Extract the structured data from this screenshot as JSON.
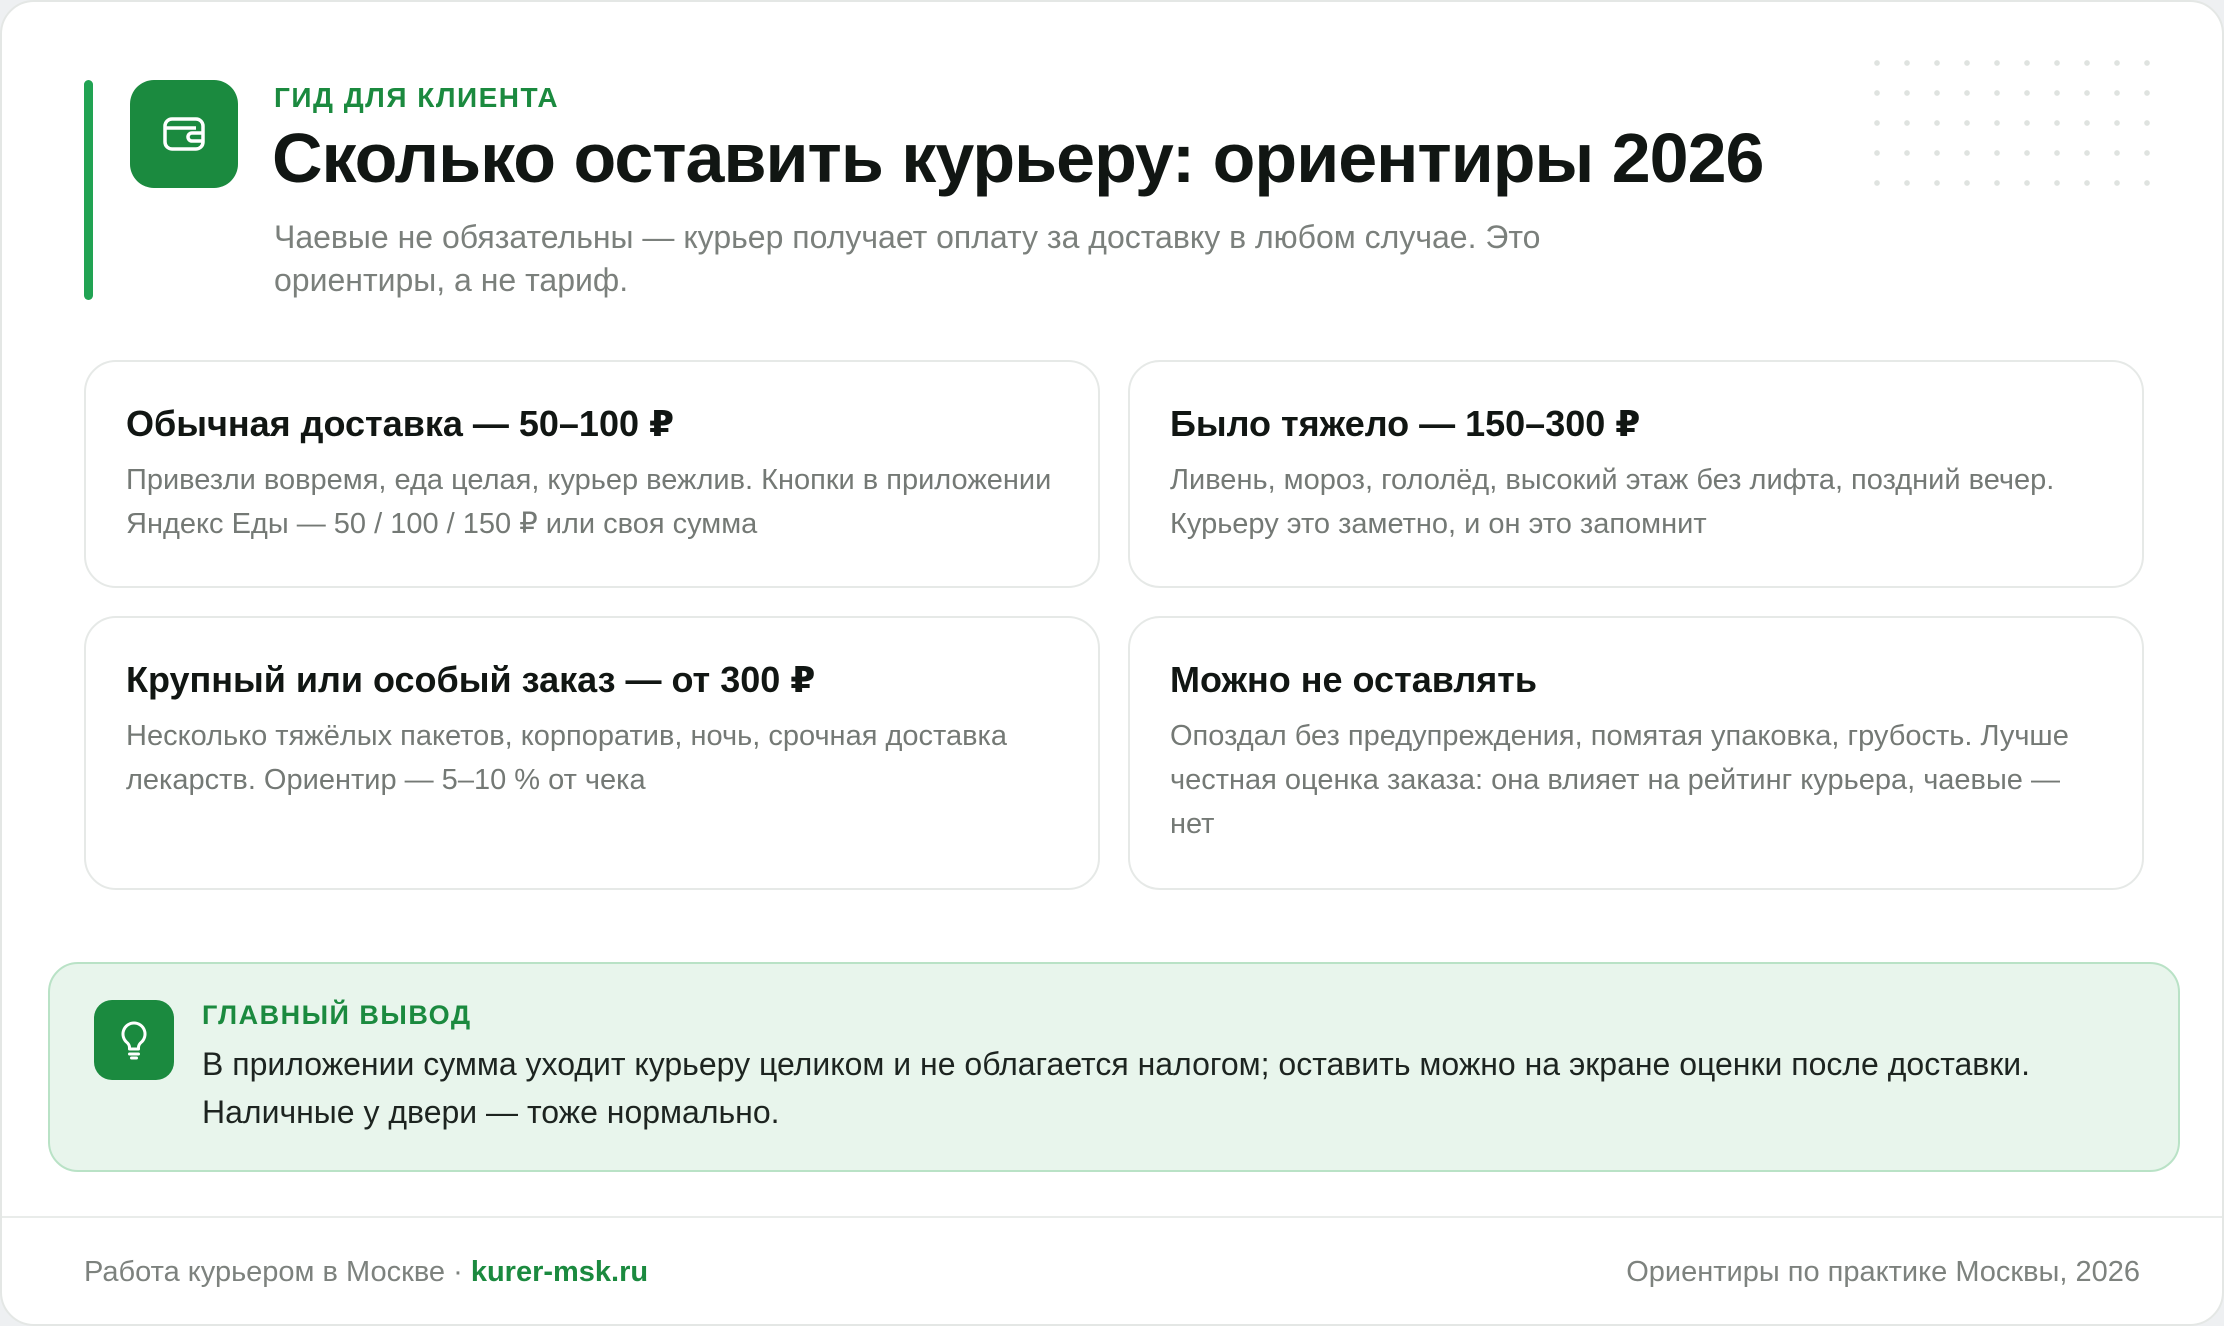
{
  "header": {
    "eyebrow": "ГИД ДЛЯ КЛИЕНТА",
    "title": "Сколько оставить курьеру: ориентиры 2026",
    "subtitle": "Чаевые не обязательны — курьер получает оплату за доставку в любом случае. Это ориентиры, а не тариф.",
    "icon": "wallet-icon"
  },
  "cards": [
    {
      "title": "Обычная доставка — 50–100 ₽",
      "text": "Привезли вовремя, еда целая, курьер вежлив. Кнопки в приложении Яндекс Еды — 50 / 100 / 150 ₽ или своя сумма"
    },
    {
      "title": "Было тяжело — 150–300 ₽",
      "text": "Ливень, мороз, гололёд, высокий этаж без лифта, поздний вечер. Курьеру это заметно, и он это запомнит"
    },
    {
      "title": "Крупный или особый заказ — от 300 ₽",
      "text": "Несколько тяжёлых пакетов, корпоратив, ночь, срочная доставка лекарств. Ориентир — 5–10 % от чека"
    },
    {
      "title": "Можно не оставлять",
      "text": "Опоздал без предупреждения, помятая упаковка, грубость. Лучше честная оценка заказа: она влияет на рейтинг курьера, чаевые — нет"
    }
  ],
  "takeaway": {
    "label": "ГЛАВНЫЙ ВЫВОД",
    "text": "В приложении сумма уходит курьеру целиком и не облагается налогом; оставить можно на экране оценки после доставки. Наличные у двери — тоже нормально.",
    "icon": "lightbulb-icon"
  },
  "footer": {
    "left_text": "Работа курьером в Москве · ",
    "site": "kurer-msk.ru",
    "right_text": "Ориентиры по практике Москвы, 2026"
  },
  "colors": {
    "accent": "#1b8a3f",
    "accent_bar": "#21a353",
    "takeaway_bg": "#e8f5ec"
  }
}
